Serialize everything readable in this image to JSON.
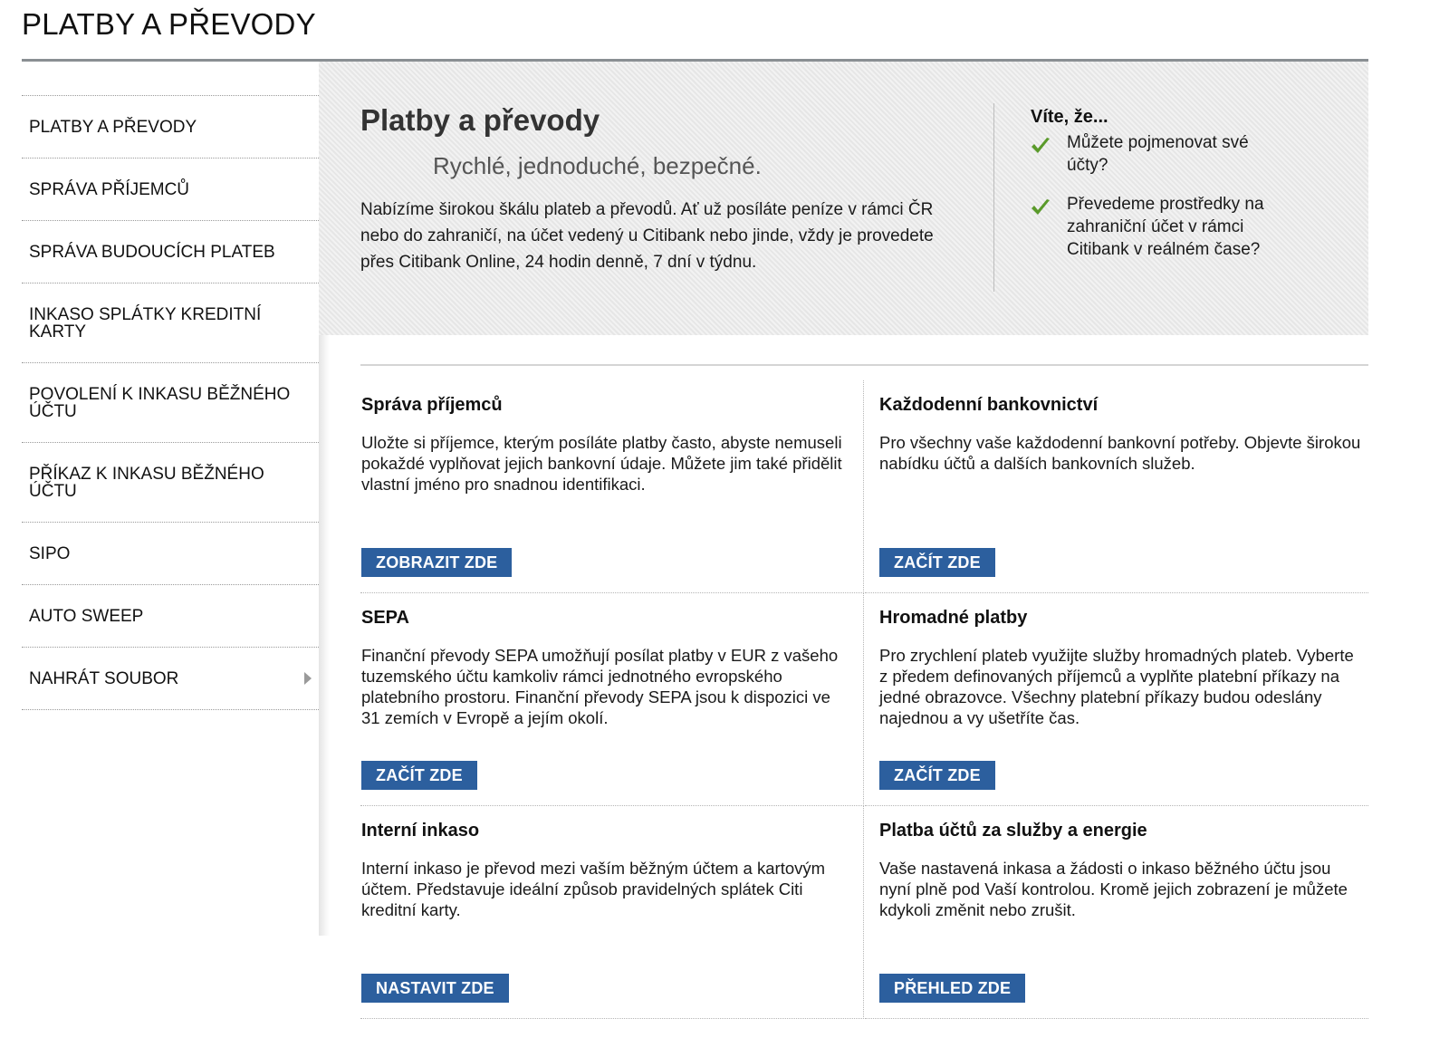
{
  "page": {
    "title": "PLATBY A PŘEVODY"
  },
  "sidebar": {
    "items": [
      {
        "label": "PLATBY A PŘEVODY"
      },
      {
        "label": "SPRÁVA PŘÍJEMCŮ"
      },
      {
        "label": "SPRÁVA BUDOUCÍCH PLATEB"
      },
      {
        "label": "INKASO SPLÁTKY KREDITNÍ KARTY"
      },
      {
        "label": "POVOLENÍ K INKASU BĚŽNÉHO ÚČTU"
      },
      {
        "label": "PŘÍKAZ K INKASU BĚŽNÉHO ÚČTU"
      },
      {
        "label": "SIPO"
      },
      {
        "label": "AUTO SWEEP"
      },
      {
        "label": "NAHRÁT SOUBOR"
      }
    ]
  },
  "hero": {
    "title": "Platby a převody",
    "subtitle": "Rychlé, jednoduché, bezpečné.",
    "text": "Nabízíme širokou škálu plateb a převodů. Ať už posíláte peníze v rámci ČR nebo do zahraničí, na účet vedený u Citibank nebo jinde, vždy je provedete přes Citibank Online, 24 hodin denně, 7 dní v týdnu."
  },
  "tips": {
    "title": "Víte, že...",
    "items": [
      {
        "text": "Můžete pojmenovat své účty?"
      },
      {
        "text": "Převedeme prostředky na zahraniční účet v rámci Citibank v reálném čase?"
      }
    ]
  },
  "tiles": [
    {
      "title": "Správa příjemců",
      "text": "Uložte si příjemce, kterým posíláte platby často, abyste nemuseli pokaždé vyplňovat jejich bankovní údaje. Můžete jim také přidělit vlastní jméno pro snadnou identifikaci.",
      "button": "ZOBRAZIT ZDE"
    },
    {
      "title": "Každodenní bankovnictví",
      "text": "Pro všechny vaše každodenní bankovní potřeby. Objevte širokou nabídku účtů a dalších bankovních služeb.",
      "button": "ZAČÍT ZDE"
    },
    {
      "title": "SEPA",
      "text": "Finanční převody SEPA umožňují posílat platby v EUR z vašeho tuzemského účtu kamkoliv rámci jednotného evropského platebního prostoru. Finanční převody SEPA jsou k dispozici ve 31 zemích v Evropě a jejím okolí.",
      "button": "ZAČÍT ZDE"
    },
    {
      "title": "Hromadné platby",
      "text": "Pro zrychlení plateb využijte služby hromadných plateb. Vyberte z předem definovaných příjemců a vyplňte platební příkazy na jedné obrazovce. Všechny platební příkazy budou odeslány najednou a vy ušetříte čas.",
      "button": "ZAČÍT ZDE"
    },
    {
      "title": "Interní inkaso",
      "text": "Interní inkaso je převod mezi vaším běžným účtem a kartovým účtem. Představuje ideální způsob pravidelných splátek Citi kreditní karty.",
      "button": "NASTAVIT ZDE"
    },
    {
      "title": "Platba účtů za služby a energie",
      "text": "Vaše nastavená inkasa a žádosti o inkaso běžného účtu jsou nyní plně pod Vaší kontrolou. Kromě jejich zobrazení je můžete kdykoli změnit nebo zrušit.",
      "button": "PŘEHLED ZDE"
    }
  ],
  "colors": {
    "button_bg": "#2c5f9e",
    "check_green": "#5a9a2a",
    "hero_bg": "#ebebeb"
  },
  "icons": {
    "check": "check-icon",
    "submenu_arrow": "chevron-right-icon"
  }
}
